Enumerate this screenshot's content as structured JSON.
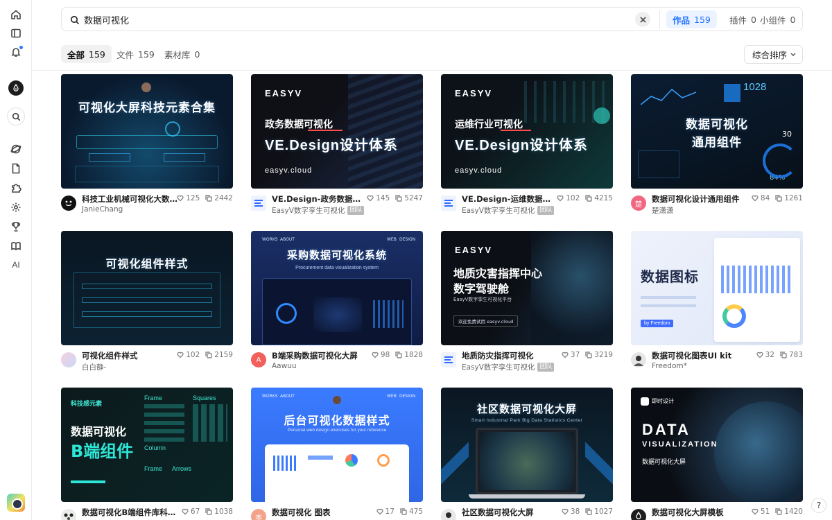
{
  "search": {
    "query": "数据可视化"
  },
  "scopes": [
    {
      "label": "作品",
      "count": "159",
      "active": true
    },
    {
      "label": "插件",
      "count": "0",
      "active": false
    },
    {
      "label": "小组件",
      "count": "0",
      "active": false
    }
  ],
  "filters": [
    {
      "label": "全部",
      "count": "159",
      "active": true
    },
    {
      "label": "文件",
      "count": "159",
      "active": false
    },
    {
      "label": "素材库",
      "count": "0",
      "active": false
    }
  ],
  "sort": {
    "label": "综合排序"
  },
  "rail": {
    "ai_label": "AI"
  },
  "help_label": "?",
  "cards": [
    {
      "title": "科技工业机械可视化大数据…",
      "author": "JanieChang",
      "tag": "",
      "likes": "125",
      "copies": "2442",
      "thumb_lines": [
        "可视化大屏科技元素合集"
      ],
      "avatar_letter": ""
    },
    {
      "title": "VE.Design-政务数据可视化",
      "author": "EasyV数字孪生可视化",
      "tag": "团队",
      "likes": "145",
      "copies": "5247",
      "thumb_lines": [
        "政务数据可视化",
        "VE.Design设计体系"
      ],
      "thumb_brand": "EASYV",
      "thumb_foot": "easyv.cloud",
      "avatar_letter": ""
    },
    {
      "title": "VE.Design-运维数据可视化",
      "author": "EasyV数字孪生可视化",
      "tag": "团队",
      "likes": "102",
      "copies": "4215",
      "thumb_lines": [
        "运维行业可视化",
        "VE.Design设计体系"
      ],
      "thumb_brand": "EASYV",
      "thumb_foot": "easyv.cloud",
      "avatar_letter": ""
    },
    {
      "title": "数据可视化设计通用组件",
      "author": "楚潇潇",
      "tag": "",
      "likes": "84",
      "copies": "1261",
      "thumb_lines": [
        "数据可视化",
        "通用组件"
      ],
      "thumb_extra": [
        "1028",
        "30",
        "84%"
      ],
      "avatar_letter": "楚"
    },
    {
      "title": "可视化组件样式",
      "author": "白白静-",
      "tag": "",
      "likes": "102",
      "copies": "2159",
      "thumb_lines": [
        "可视化组件样式"
      ],
      "avatar_letter": ""
    },
    {
      "title": "B端采购数据可视化大屏",
      "author": "Aawuu",
      "tag": "",
      "likes": "98",
      "copies": "1828",
      "thumb_lines": [
        "采购数据可视化系统",
        "Procurement data visualization system"
      ],
      "thumb_nav": [
        "WORKS",
        "ABOUT",
        "WEB",
        "DESIGN"
      ],
      "avatar_letter": "A"
    },
    {
      "title": "地质防灾指挥可视化",
      "author": "EasyV数字孪生可视化",
      "tag": "团队",
      "likes": "37",
      "copies": "3219",
      "thumb_lines": [
        "地质灾害指挥中心",
        "数字驾驶舱",
        "EasyV数字孪生可视化平台",
        "欢迎免费试用  easyv.cloud"
      ],
      "thumb_brand": "EASYV",
      "avatar_letter": ""
    },
    {
      "title": "数据可视化图表UI kit",
      "author": "Freedom*",
      "tag": "",
      "likes": "32",
      "copies": "783",
      "thumb_lines": [
        "数据图标",
        "by Freedom"
      ],
      "avatar_letter": ""
    },
    {
      "title": "数据可视化B端组件库科技…",
      "author": "",
      "tag": "",
      "likes": "67",
      "copies": "1038",
      "thumb_lines": [
        "科技感元素",
        "数据可视化",
        "B端组件"
      ],
      "thumb_extra": [
        "Frame",
        "Squares",
        "Column",
        "Frame",
        "Arrows"
      ],
      "avatar_letter": ""
    },
    {
      "title": "数据可视化 图表",
      "author": "",
      "tag": "",
      "likes": "17",
      "copies": "475",
      "thumb_lines": [
        "后台可视化数据样式",
        "Personal web design exercises for your reference"
      ],
      "thumb_nav": [
        "WORKS",
        "ABOUT",
        "WEB",
        "DESIGN"
      ],
      "avatar_letter": "本"
    },
    {
      "title": "社区数据可视化大屏",
      "author": "",
      "tag": "",
      "likes": "38",
      "copies": "1027",
      "thumb_lines": [
        "社区数据可视化大屏",
        "Smart Industrial Park Big Data Statistics Center"
      ],
      "avatar_letter": ""
    },
    {
      "title": "数据可视化大屏模板",
      "author": "",
      "tag": "",
      "likes": "51",
      "copies": "1420",
      "thumb_lines": [
        "DATA",
        "VISUALIZATION",
        "数据可视化大屏",
        "即时设计"
      ],
      "avatar_letter": ""
    }
  ],
  "colors": {
    "accent": "#1e6fff",
    "accent_bg": "#eaf3ff"
  }
}
